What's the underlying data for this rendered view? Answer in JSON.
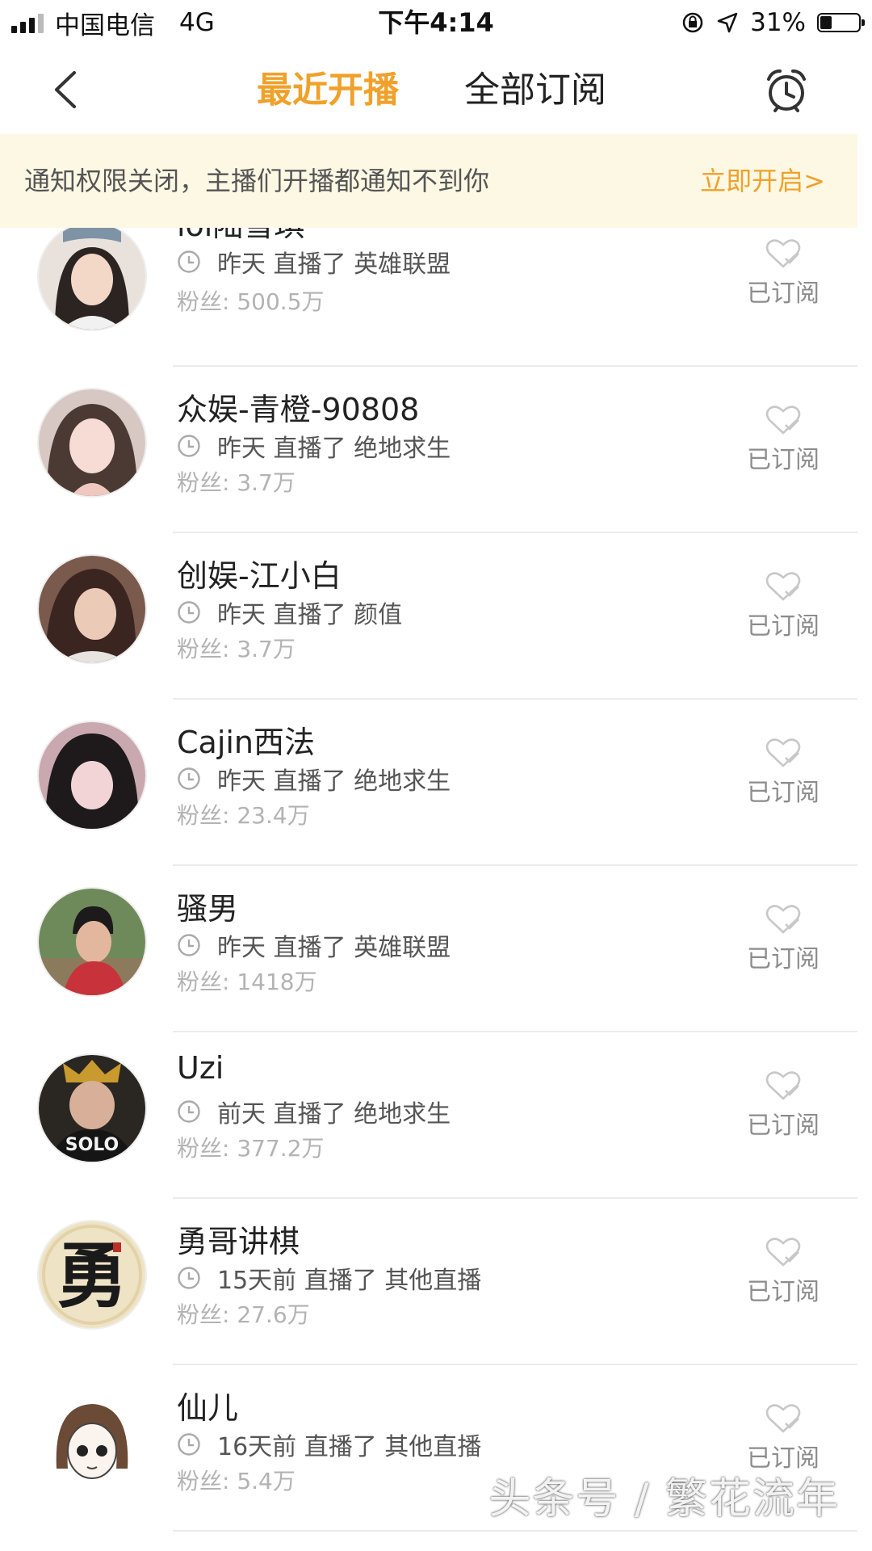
{
  "status_bar": {
    "carrier": "中国电信",
    "network": "4G",
    "time": "下午4:14",
    "battery_percent": "31%",
    "battery_level": 0.31
  },
  "nav": {
    "tab_recent": "最近开播",
    "tab_all": "全部订阅",
    "active_tab": "最近开播",
    "icons": {
      "back": "chevron-left-icon",
      "alarm": "alarm-clock-icon"
    }
  },
  "banner": {
    "text": "通知权限关闭，主播们开播都通知不到你",
    "action": "立即开启>"
  },
  "streamers": [
    {
      "name": "lol陆雪琪",
      "when": "昨天",
      "action": "直播了",
      "category": "英雄联盟",
      "fans_label": "粉丝:",
      "fans": "500.5万",
      "subscribed_label": "已订阅"
    },
    {
      "name": "众娱-青橙-90808",
      "when": "昨天",
      "action": "直播了",
      "category": "绝地求生",
      "fans_label": "粉丝:",
      "fans": "3.7万",
      "subscribed_label": "已订阅"
    },
    {
      "name": "创娱-江小白",
      "when": "昨天",
      "action": "直播了",
      "category": "颜值",
      "fans_label": "粉丝:",
      "fans": "3.7万",
      "subscribed_label": "已订阅"
    },
    {
      "name": "Cajin西法",
      "when": "昨天",
      "action": "直播了",
      "category": "绝地求生",
      "fans_label": "粉丝:",
      "fans": "23.4万",
      "subscribed_label": "已订阅"
    },
    {
      "name": "骚男",
      "when": "昨天",
      "action": "直播了",
      "category": "英雄联盟",
      "fans_label": "粉丝:",
      "fans": "1418万",
      "subscribed_label": "已订阅"
    },
    {
      "name": "Uzi",
      "when": "前天",
      "action": "直播了",
      "category": "绝地求生",
      "fans_label": "粉丝:",
      "fans": "377.2万",
      "subscribed_label": "已订阅"
    },
    {
      "name": "勇哥讲棋",
      "when": "15天前",
      "action": "直播了",
      "category": "其他直播",
      "fans_label": "粉丝:",
      "fans": "27.6万",
      "subscribed_label": "已订阅"
    },
    {
      "name": "仙儿",
      "when": "16天前",
      "action": "直播了",
      "category": "其他直播",
      "fans_label": "粉丝:",
      "fans": "5.4万",
      "subscribed_label": "已订阅"
    }
  ],
  "avatar_badges": {
    "uzi": "SOLO",
    "yongge": "勇"
  },
  "watermark": "头条号 / 繁花流年",
  "colors": {
    "accent": "#f0a12a",
    "banner_bg": "#fdf8e4",
    "muted": "#b3b3b3"
  }
}
